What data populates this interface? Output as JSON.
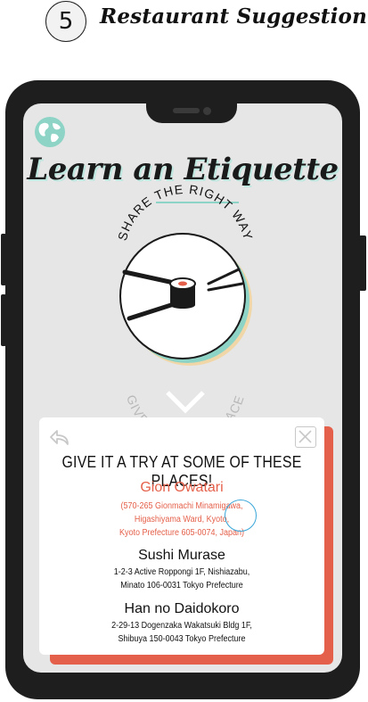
{
  "header": {
    "step_number": "5",
    "step_title": "Restaurant Suggestion"
  },
  "screen": {
    "title": "Learn an Etiquette",
    "illustration": {
      "top_arc_text": "SHARE THE RIGHT WAY",
      "bottom_arc_text": "GIVE 'EM SOME SPACE"
    }
  },
  "modal": {
    "heading": "GIVE IT A TRY AT SOME OF THESE PLACES!",
    "places": [
      {
        "name": "Gion Owatari",
        "address_lines": [
          "(570-265 Gionmachi Minamigawa,",
          "Higashiyama Ward, Kyoto,",
          "Kyoto Prefecture 605-0074, Japan)"
        ],
        "highlighted": true
      },
      {
        "name": "Sushi Murase",
        "address_lines": [
          "1-2-3 Active Roppongi 1F, Nishiazabu,",
          "Minato 106-0031 Tokyo Prefecture"
        ],
        "highlighted": false
      },
      {
        "name": "Han no Daidokoro",
        "address_lines": [
          "2-29-13 Dogenzaka Wakatsuki Bldg 1F,",
          "Shibuya 150-0043 Tokyo Prefecture"
        ],
        "highlighted": false
      }
    ]
  },
  "icons": {
    "globe": "globe-icon",
    "back": "back-arrow-icon",
    "close": "close-icon",
    "sushi": "sushi-chopsticks-illustration",
    "chevron": "chevron-down-icon"
  },
  "colors": {
    "accent": "#e5604a",
    "teal": "#8ed4c6",
    "sand": "#f1d7a8",
    "phone": "#1e1e1e",
    "screen": "#e6e6e6",
    "cursor": "#3aa6d8"
  }
}
